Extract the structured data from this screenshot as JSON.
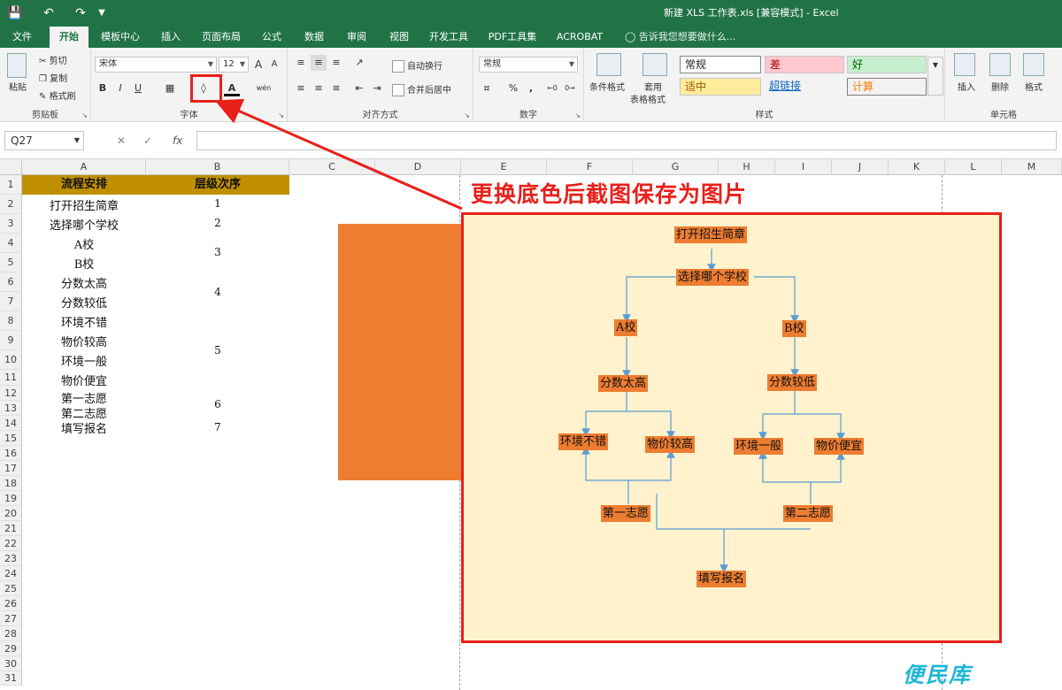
{
  "window": {
    "title": "新建 XLS 工作表.xls  [兼容模式] - Excel"
  },
  "quick_access": {
    "save_icon": "save-icon",
    "undo_icon": "undo-icon",
    "redo_icon": "redo-icon",
    "customize_icon": "customize-icon"
  },
  "tabs": [
    "文件",
    "开始",
    "模板中心",
    "插入",
    "页面布局",
    "公式",
    "数据",
    "审阅",
    "视图",
    "开发工具",
    "PDF工具集",
    "ACROBAT"
  ],
  "active_tab": "开始",
  "tell_me": "告诉我您想要做什么...",
  "ribbon": {
    "clipboard": {
      "label": "剪贴板",
      "paste": "粘贴",
      "cut": "剪切",
      "copy": "复制",
      "format_painter": "格式刷"
    },
    "font": {
      "label": "字体",
      "font_name": "宋体",
      "font_size": "12",
      "bold": "B",
      "italic": "I",
      "underline": "U",
      "grow": "A",
      "shrink": "A",
      "font_color_glyph": "A",
      "phonetic": "wén"
    },
    "alignment": {
      "label": "对齐方式",
      "wrap": "自动换行",
      "merge": "合并后居中"
    },
    "number": {
      "label": "数字",
      "format": "常规",
      "percent": "%",
      "comma": ","
    },
    "styles": {
      "label": "样式",
      "cond_format": "条件格式",
      "table_format_1": "套用",
      "table_format_2": "表格格式",
      "normal": "常规",
      "bad": "差",
      "good": "好",
      "neutral": "适中",
      "hyperlink": "超链接",
      "calculation": "计算"
    },
    "cells": {
      "label": "单元格",
      "insert": "插入",
      "delete": "删除",
      "format": "格式"
    }
  },
  "formula_bar": {
    "name_box": "Q27",
    "fx": "fx",
    "value": ""
  },
  "columns": [
    "A",
    "B",
    "C",
    "D",
    "E",
    "F",
    "G",
    "H",
    "I",
    "J",
    "K",
    "L",
    "M"
  ],
  "rows": [
    "1",
    "2",
    "3",
    "4",
    "5",
    "6",
    "7",
    "8",
    "9",
    "10",
    "11",
    "12",
    "13",
    "14",
    "15",
    "16",
    "17",
    "18",
    "19",
    "20",
    "21",
    "22",
    "23",
    "24",
    "25",
    "26",
    "27",
    "28",
    "29",
    "30",
    "31"
  ],
  "table": {
    "header_a": "流程安排",
    "header_b": "层级次序",
    "col_a": [
      "打开招生简章",
      "选择哪个学校",
      "A校",
      "B校",
      "分数太高",
      "分数较低",
      "环境不错",
      "物价较高",
      "环境一般",
      "物价便宜",
      "第一志愿",
      "第二志愿",
      "填写报名"
    ],
    "col_b": [
      "1",
      "2",
      "3",
      "4",
      "5",
      "6",
      "7"
    ]
  },
  "annotation": "更换底色后截图保存为图片",
  "flowchart": {
    "nodes": [
      "打开招生简章",
      "选择哪个学校",
      "A校",
      "B校",
      "分数太高",
      "分数较低",
      "环境不错",
      "物价较高",
      "环境一般",
      "物价便宜",
      "第一志愿",
      "第二志愿",
      "填写报名"
    ]
  },
  "watermark": "便民库",
  "colors": {
    "excel_green": "#217346",
    "header_gold": "#bf8f00",
    "node_orange": "#ed7d31",
    "panel_fill": "#fff2cc",
    "highlight_red": "#e8201b"
  }
}
